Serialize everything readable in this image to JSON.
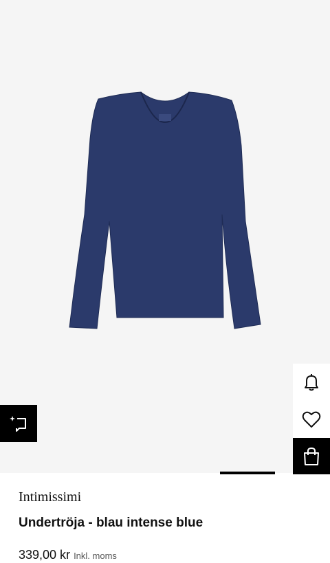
{
  "product": {
    "brand": "Intimissimi",
    "title": "Undertröja - blau intense blue",
    "price": "339,00 kr",
    "vat_note": "Inkl. moms",
    "garment_color": "#2b3a6b"
  },
  "actions": {
    "notify_icon": "bell-icon",
    "wishlist_icon": "heart-icon",
    "bag_icon": "shopping-bag-icon",
    "feedback_icon": "sparkle-feedback-icon"
  },
  "colors": {
    "background": "#f5f5f5",
    "button_dark": "#000000",
    "text": "#111111"
  }
}
